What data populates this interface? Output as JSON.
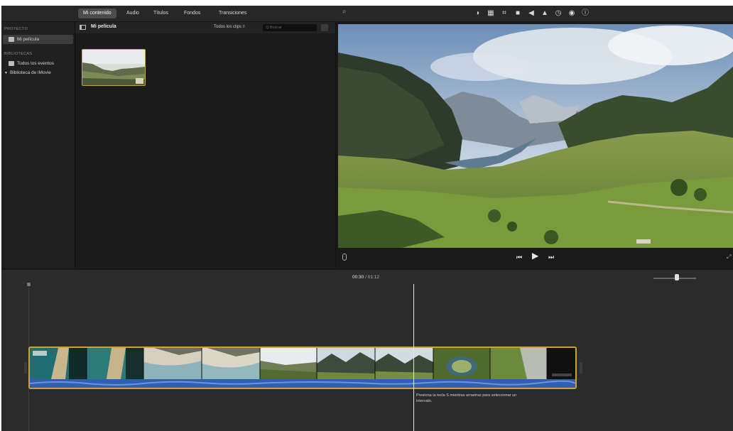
{
  "toolbar": {
    "tabs": [
      {
        "label": "Mi contenido",
        "active": true
      },
      {
        "label": "Audio"
      },
      {
        "label": "Títulos"
      },
      {
        "label": "Fondos"
      },
      {
        "label": "Transiciones"
      }
    ],
    "tool_icons": [
      "color-balance-icon",
      "color-correction-icon",
      "crop-icon",
      "stabilization-icon",
      "volume-icon",
      "noise-reduction-icon",
      "speed-icon",
      "clip-filter-icon",
      "info-icon"
    ]
  },
  "sidebar": {
    "projects_header": "PROYECTO",
    "project_item": "Mi película",
    "libraries_header": "BIBLIOTECAS",
    "all_events": "Todos los eventos",
    "library_item": "Biblioteca de iMovie"
  },
  "browser": {
    "title": "Mi película",
    "filter": "Todos los clips ◊",
    "search_placeholder": "Q Buscar"
  },
  "timeline": {
    "current_time": "00:30",
    "total_time": "/ 01:12",
    "tooltip": "Presiona la tecla S mientras arrastras para seleccionar un intervalo."
  },
  "colors": {
    "accent_gold": "#c9a238",
    "audio_blue": "#2e5fb0",
    "panel_dark": "#1e1e1e",
    "timeline_bg": "#2b2b2b"
  }
}
